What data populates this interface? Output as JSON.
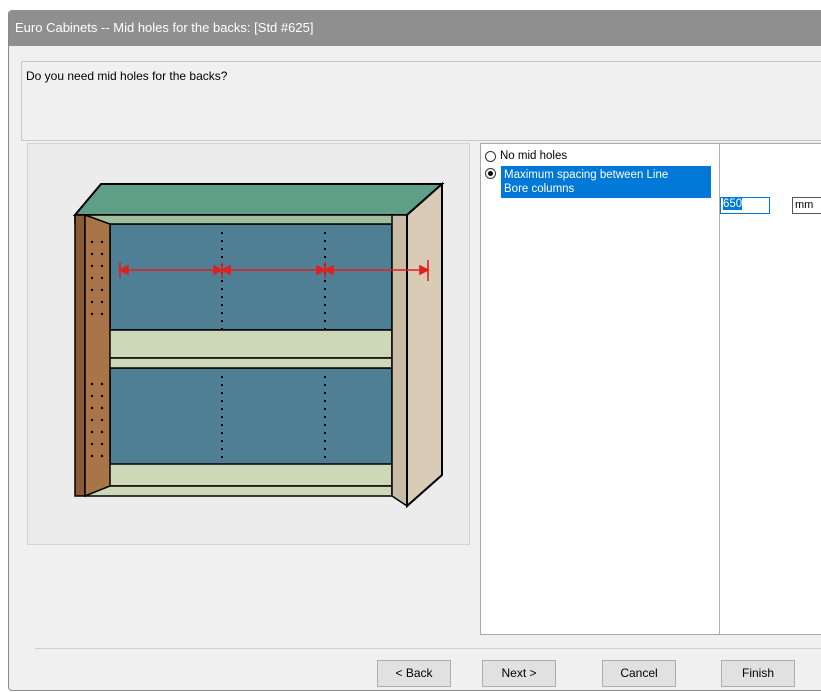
{
  "window": {
    "title": "Euro Cabinets -- Mid holes for the backs: [Std #625]"
  },
  "question": "Do you need mid holes for the backs?",
  "options": [
    {
      "label": "No mid holes",
      "selected": false
    },
    {
      "label": "Maximum spacing between Line\nBore columns",
      "selected": true
    }
  ],
  "spacing_value": "650",
  "spacing_unit": "mm",
  "buttons": {
    "back": "< Back",
    "next": "Next >",
    "cancel": "Cancel",
    "finish": "Finish"
  },
  "colors": {
    "selection": "#0078d7",
    "cabinet_top": "#5f9f87",
    "back_panel": "#4e7f95",
    "shelf": "#cdd8b8",
    "left_side": "#a97448",
    "right_side": "#d8ccb6",
    "dimension_line": "#e0201e"
  }
}
